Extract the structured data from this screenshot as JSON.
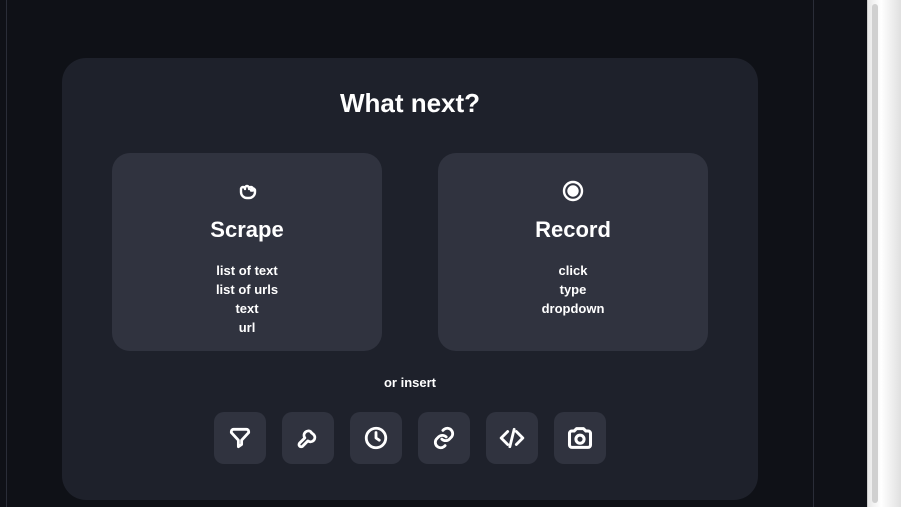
{
  "panel": {
    "title": "What next?",
    "or_insert_label": "or insert"
  },
  "options": {
    "scrape": {
      "title": "Scrape",
      "items": [
        "list of text",
        "list of urls",
        "text",
        "url"
      ]
    },
    "record": {
      "title": "Record",
      "items": [
        "click",
        "type",
        "dropdown"
      ]
    }
  },
  "tools": [
    {
      "name": "filter"
    },
    {
      "name": "wrench"
    },
    {
      "name": "clock"
    },
    {
      "name": "link"
    },
    {
      "name": "code"
    },
    {
      "name": "camera"
    }
  ]
}
